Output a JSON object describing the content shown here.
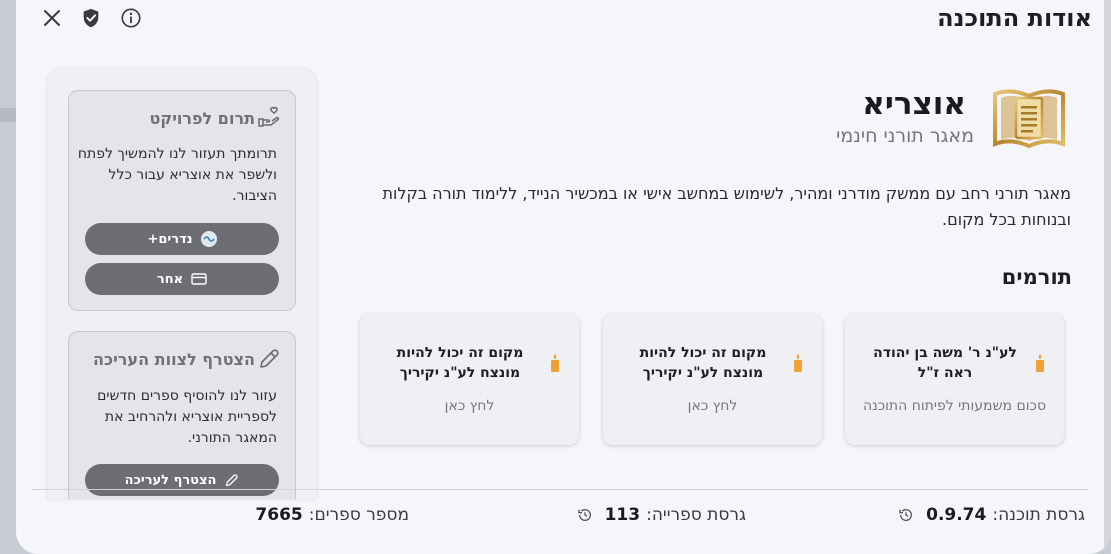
{
  "dialog": {
    "title": "אודות התוכנה",
    "icons": {
      "close": "close-icon",
      "shield": "shield-icon",
      "info": "info-icon"
    }
  },
  "app": {
    "name": "אוצריא",
    "subtitle": "מאגר תורני חינמי",
    "description": "מאגר תורני רחב עם ממשק מודרני ומהיר, לשימוש במחשב אישי או במכשיר הנייד, ללימוד תורה בקלות ובנוחות בכל מקום.",
    "logo": "book-logo-icon"
  },
  "donors": {
    "title": "תורמים",
    "cards": [
      {
        "title": "לע\"נ ר' משה בן יהודה ראה ז\"ל",
        "subtitle": "סכום משמעותי לפיתוח התוכנה",
        "icon": "candle-icon"
      },
      {
        "title": "מקום זה יכול להיות מונצח לע\"נ יקיריך",
        "subtitle": "לחץ כאן",
        "icon": "candle-icon"
      },
      {
        "title": "מקום זה יכול להיות מונצח לע\"נ יקיריך",
        "subtitle": "לחץ כאן",
        "icon": "candle-icon"
      }
    ]
  },
  "side": {
    "donate": {
      "title": "תרום לפרויקט",
      "text": "תרומתך תעזור לנו להמשיך לפתח ולשפר את אוצריא עבור כלל הציבור.",
      "nedarim_label": "נדרים+",
      "other_label": "אחר"
    },
    "edit": {
      "title": "הצטרף לצוות העריכה",
      "text": "עזור לנו להוסיף ספרים חדשים לספריית אוצריא ולהרחיב את המאגר התורני.",
      "join_label": "הצטרף לעריכה"
    }
  },
  "footer": {
    "app_version_label": "גרסת תוכנה:",
    "app_version": "0.9.74",
    "library_version_label": "גרסת ספרייה:",
    "library_version": "113",
    "books_count_label": "מספר ספרים:",
    "books_count": "7665"
  },
  "colors": {
    "accent_gold": "#c8a04a",
    "candle": "#f0a030",
    "pill": "#6d6e73"
  }
}
